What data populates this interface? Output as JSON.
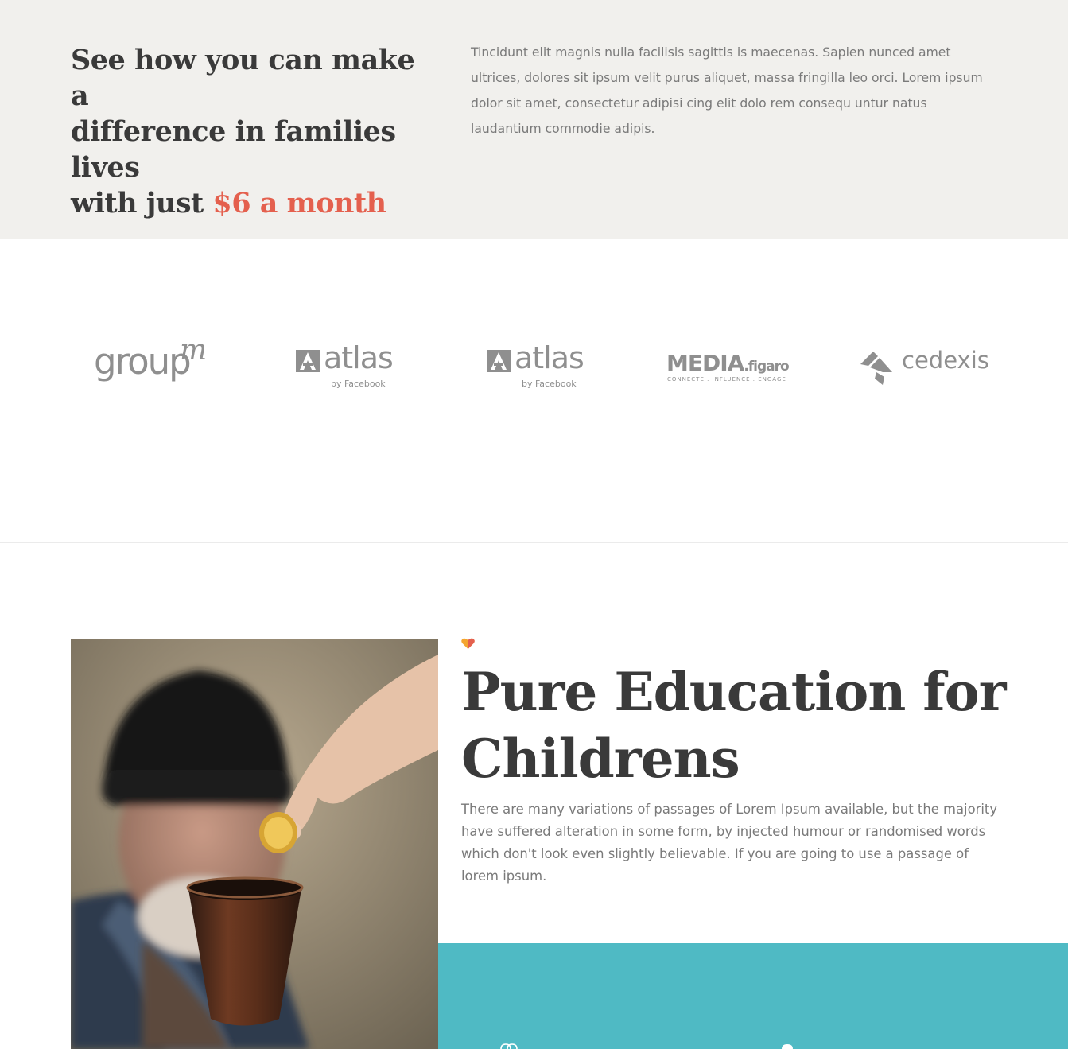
{
  "intro": {
    "heading_line1": "See how you can make a",
    "heading_line2": "difference in families lives",
    "heading_line3_prefix": "with just ",
    "heading_accent": "$6 a month",
    "paragraph": "Tincidunt elit magnis nulla facilisis sagittis is maecenas. Sapien nunced amet ultrices, dolores sit ipsum velit purus aliquet, massa fringilla leo orci. Lorem ipsum dolor sit amet, consectetur adipisi cing elit dolo rem consequ untur natus laudantium commodie adipis."
  },
  "partners": [
    {
      "name": "groupm",
      "word": "group",
      "sup": "m"
    },
    {
      "name": "atlas",
      "word": "atlas",
      "sub": "by Facebook"
    },
    {
      "name": "atlas",
      "word": "atlas",
      "sub": "by Facebook"
    },
    {
      "name": "MEDIA.figaro",
      "word": "MEDIA",
      "word_small": ".figaro",
      "sub": "CONNECTE . INFLUENCE . ENGAGE"
    },
    {
      "name": "cedexis",
      "word": "cedexis"
    }
  ],
  "education": {
    "title_line1": "Pure Education for",
    "title_line2": "Childrens",
    "paragraph": "There are many variations of passages of Lorem Ipsum available, but the majority have suffered alteration in some form, by injected humour or randomised words which don't look even slightly believable. If you are going to use a passage of lorem ipsum."
  },
  "colors": {
    "accent": "#e4604e",
    "band_background": "#f1f0ed",
    "teal": "#4fbac4",
    "heading": "#3a3a3a",
    "body_text": "#7a7a7a",
    "logo_gray": "#8f8f8f"
  },
  "icons": {
    "section_icon": "heart-icon",
    "panel_icon_1": "donation-icon",
    "panel_icon_2": "person-icon"
  }
}
